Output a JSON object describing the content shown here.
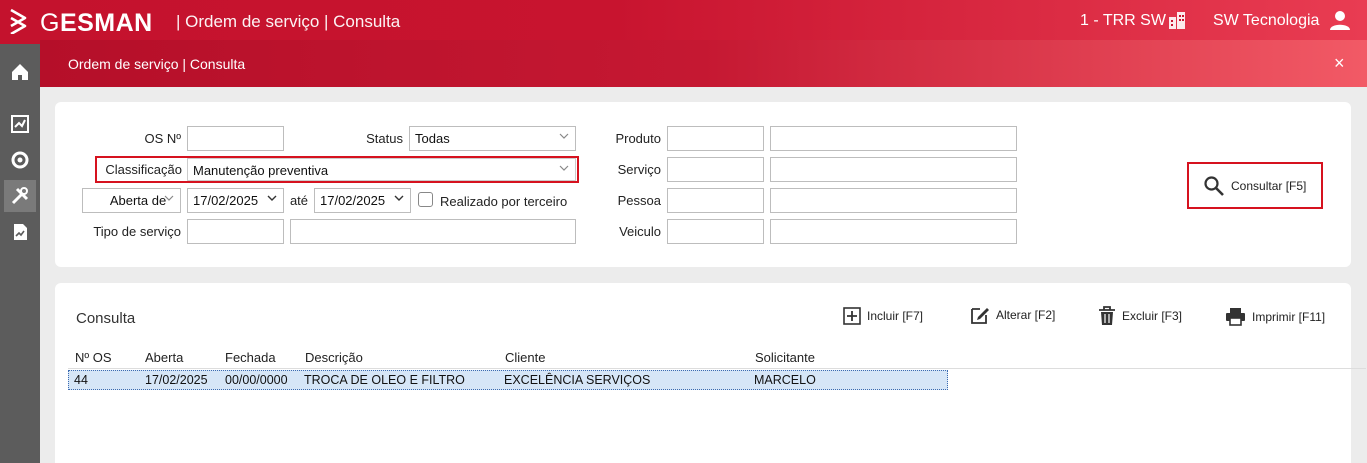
{
  "header": {
    "brand_g": "G",
    "brand_rest": "ESMAN",
    "page_title": "| Ordem de serviço | Consulta",
    "company": "1 - TRR SW",
    "user": "SW Tecnologia"
  },
  "sidebar": {
    "items": [
      {
        "icon": "home-icon"
      },
      {
        "icon": "dashboard-icon"
      },
      {
        "icon": "settings-icon"
      },
      {
        "icon": "tools-icon",
        "active": true
      },
      {
        "icon": "report-icon"
      }
    ]
  },
  "subheader": {
    "title": "Ordem de serviço | Consulta",
    "close": "×"
  },
  "filters": {
    "os_label": "OS Nº",
    "os_value": "",
    "status_label": "Status",
    "status_value": "Todas",
    "classificacao_label": "Classificação",
    "classificacao_value": "Manutenção preventiva",
    "date_type_value": "Aberta de",
    "date_from": "17/02/2025",
    "ate_label": "até",
    "date_to": "17/02/2025",
    "terceiro_label": "Realizado por terceiro",
    "tipo_servico_label": "Tipo de serviço",
    "produto_label": "Produto",
    "servico_label": "Serviço",
    "pessoa_label": "Pessoa",
    "veiculo_label": "Veiculo"
  },
  "actions": {
    "consultar": "Consultar [F5]",
    "incluir": "Incluir [F7]",
    "alterar": "Alterar [F2]",
    "excluir": "Excluir [F3]",
    "imprimir": "Imprimir [F11]"
  },
  "results": {
    "title": "Consulta",
    "columns": [
      "Nº OS",
      "Aberta",
      "Fechada",
      "Descrição",
      "Cliente",
      "Solicitante"
    ],
    "rows": [
      [
        "44",
        "17/02/2025",
        "00/00/0000",
        "TROCA DE OLEO E FILTRO",
        "EXCELÊNCIA SERVIÇOS",
        "MARCELO"
      ]
    ]
  },
  "colors": {
    "brand_red": "#c4122d",
    "highlight": "#d6121f",
    "sidebar": "#5c5c5c",
    "selected_row": "#d6e6f7"
  }
}
